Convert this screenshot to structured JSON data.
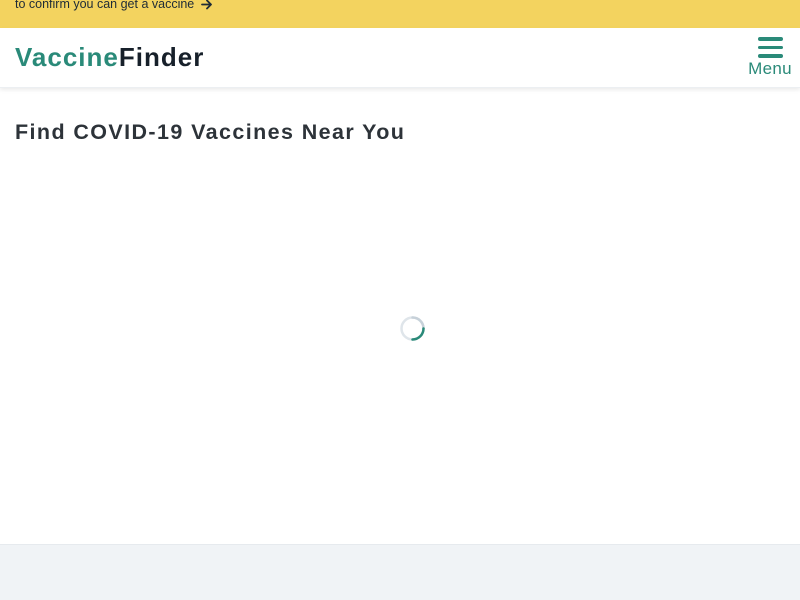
{
  "banner": {
    "text": "to confirm you can get a vaccine",
    "icon": "arrow-right-icon",
    "background_color": "#f3d35f"
  },
  "header": {
    "logo_part_a": "Vaccine",
    "logo_part_b": "Finder",
    "menu_label": "Menu",
    "menu_icon": "hamburger-icon",
    "accent_color": "#2a8a79"
  },
  "main": {
    "title": "Find COVID-19 Vaccines Near You",
    "loading_indicator": "spinner-icon"
  },
  "footer": {
    "background_color": "#f0f3f6"
  }
}
